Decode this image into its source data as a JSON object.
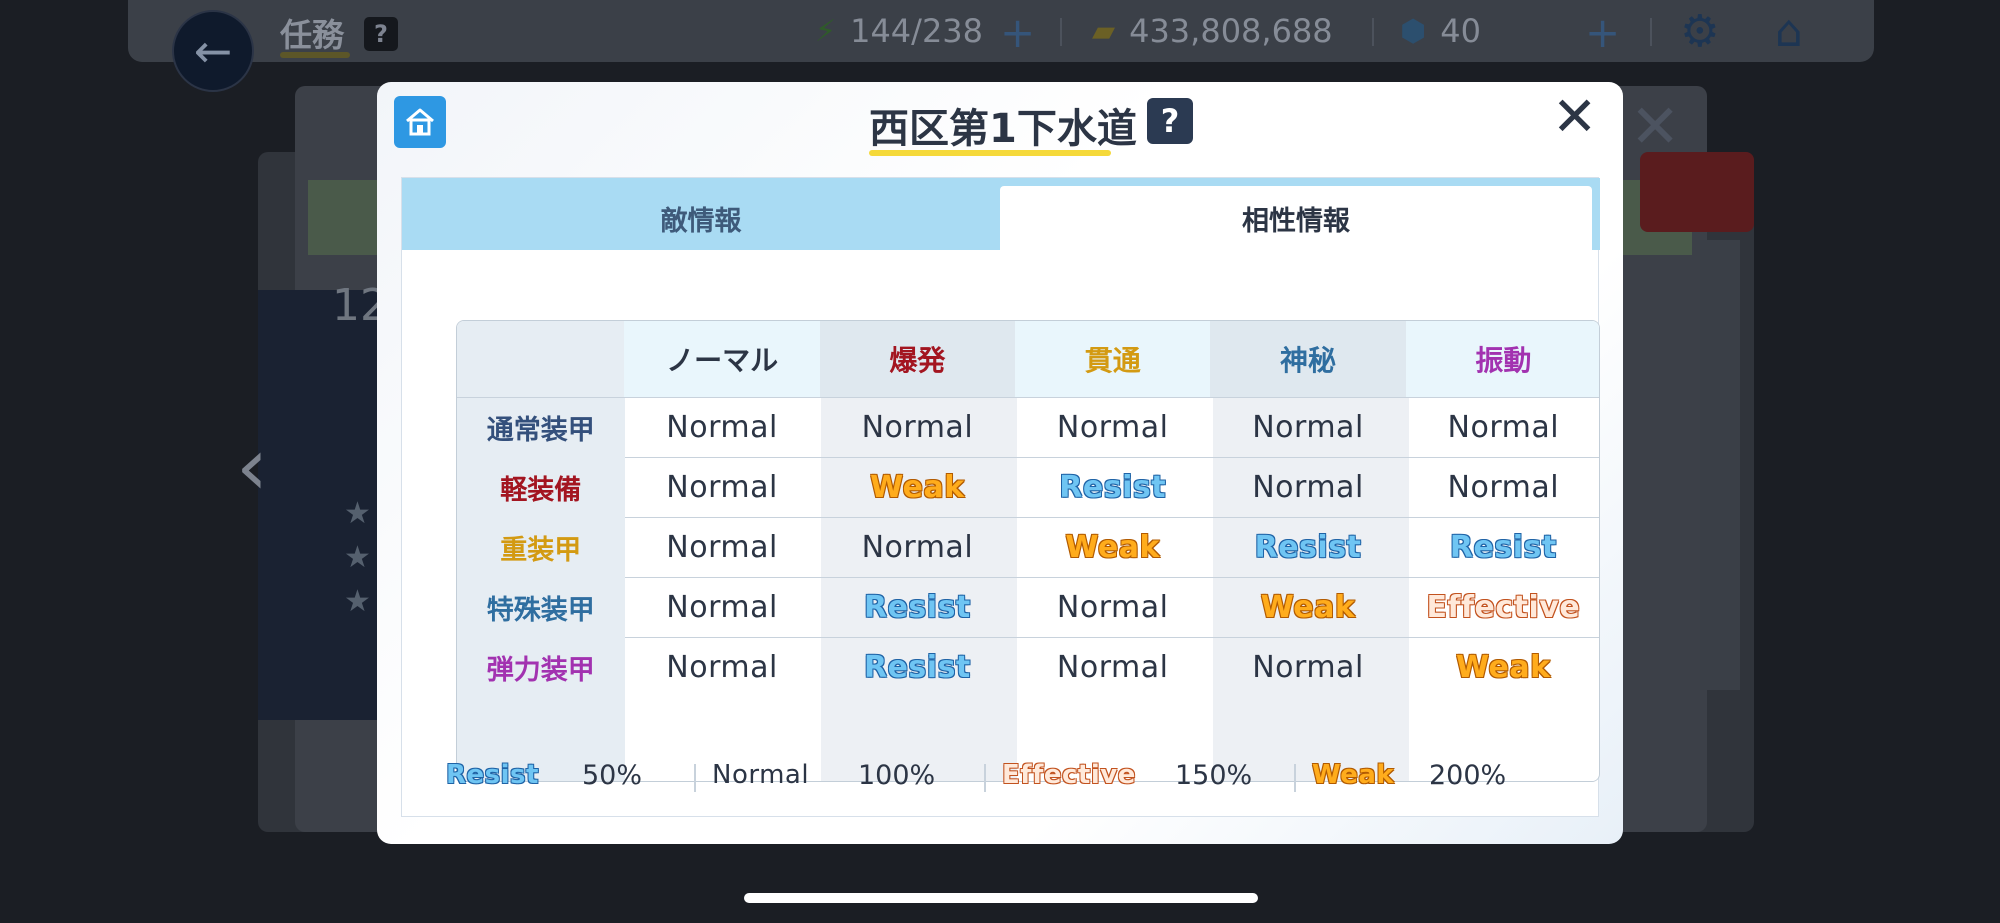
{
  "background": {
    "title": "任務",
    "help": "?",
    "stamina": "144/238",
    "credits": "433,808,688",
    "gems": "40",
    "number_text": "12"
  },
  "dialog": {
    "title": "西区第1下水道",
    "help": "?",
    "tabs": [
      {
        "label": "敵情報",
        "active": false
      },
      {
        "label": "相性情報",
        "active": true
      }
    ],
    "columns": [
      {
        "label": "ノーマル",
        "color": "#2c3545",
        "bg": "#e9f6fc"
      },
      {
        "label": "爆発",
        "color": "#a31520",
        "bg": "#dfe8ef"
      },
      {
        "label": "貫通",
        "color": "#d39a12",
        "bg": "#e9f6fc"
      },
      {
        "label": "神秘",
        "color": "#2f6ea0",
        "bg": "#dfe8ef"
      },
      {
        "label": "振動",
        "color": "#a232b0",
        "bg": "#e9f6fc"
      }
    ],
    "rows": [
      {
        "label": "通常装甲",
        "color": "#34507c",
        "cells": [
          "Normal",
          "Normal",
          "Normal",
          "Normal",
          "Normal"
        ]
      },
      {
        "label": "軽装備",
        "color": "#a31520",
        "cells": [
          "Normal",
          "Weak",
          "Resist",
          "Normal",
          "Normal"
        ]
      },
      {
        "label": "重装甲",
        "color": "#d39a12",
        "cells": [
          "Normal",
          "Normal",
          "Weak",
          "Resist",
          "Resist"
        ]
      },
      {
        "label": "特殊装甲",
        "color": "#2f6ea0",
        "cells": [
          "Normal",
          "Resist",
          "Normal",
          "Weak",
          "Effective"
        ]
      },
      {
        "label": "弾力装甲",
        "color": "#a232b0",
        "cells": [
          "Normal",
          "Resist",
          "Normal",
          "Normal",
          "Weak"
        ]
      }
    ],
    "legend": [
      {
        "label": "Resist",
        "value": "50%"
      },
      {
        "label": "Normal",
        "value": "100%"
      },
      {
        "label": "Effective",
        "value": "150%"
      },
      {
        "label": "Weak",
        "value": "200%"
      }
    ]
  }
}
